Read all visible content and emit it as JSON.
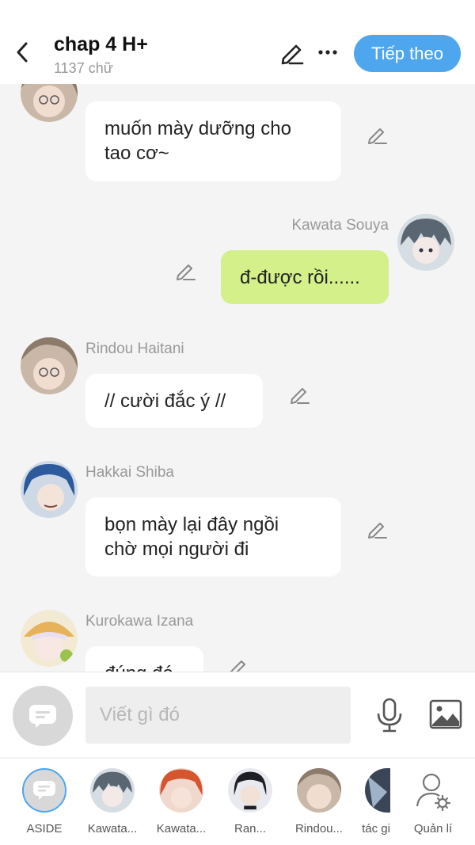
{
  "header": {
    "title": "chap 4 H+",
    "subtitle": "1137 chữ",
    "next_label": "Tiếp theo"
  },
  "messages": [
    {
      "sender": "",
      "text": "muốn mày dưỡng cho\ntao cơ~",
      "side": "left"
    },
    {
      "sender": "Kawata Souya",
      "text": "đ-được rồi......",
      "side": "right"
    },
    {
      "sender": "Rindou Haitani",
      "text": "// cười đắc ý //",
      "side": "left"
    },
    {
      "sender": "Hakkai Shiba",
      "text": "bọn mày lại đây ngồi\nchờ mọi người đi",
      "side": "left"
    },
    {
      "sender": "Kurokawa Izana",
      "text": "đúng đó",
      "side": "left"
    }
  ],
  "input": {
    "placeholder": "Viết gì đó"
  },
  "characters": [
    {
      "label": "ASIDE"
    },
    {
      "label": "Kawata..."
    },
    {
      "label": "Kawata..."
    },
    {
      "label": "Ran..."
    },
    {
      "label": "Rindou..."
    },
    {
      "label": "tác gi"
    },
    {
      "label": "Quản lí"
    }
  ],
  "colors": {
    "accent": "#4ea7ee",
    "my_bubble": "#d3f08a",
    "bubble": "#ffffff",
    "background": "#f4f4f4"
  },
  "icons": {
    "back": "chevron-left-icon",
    "edit": "pencil-icon",
    "more": "more-horizontal-icon",
    "mic": "microphone-icon",
    "image": "image-icon",
    "aside": "chat-bubble-icon",
    "manage": "user-settings-icon"
  }
}
